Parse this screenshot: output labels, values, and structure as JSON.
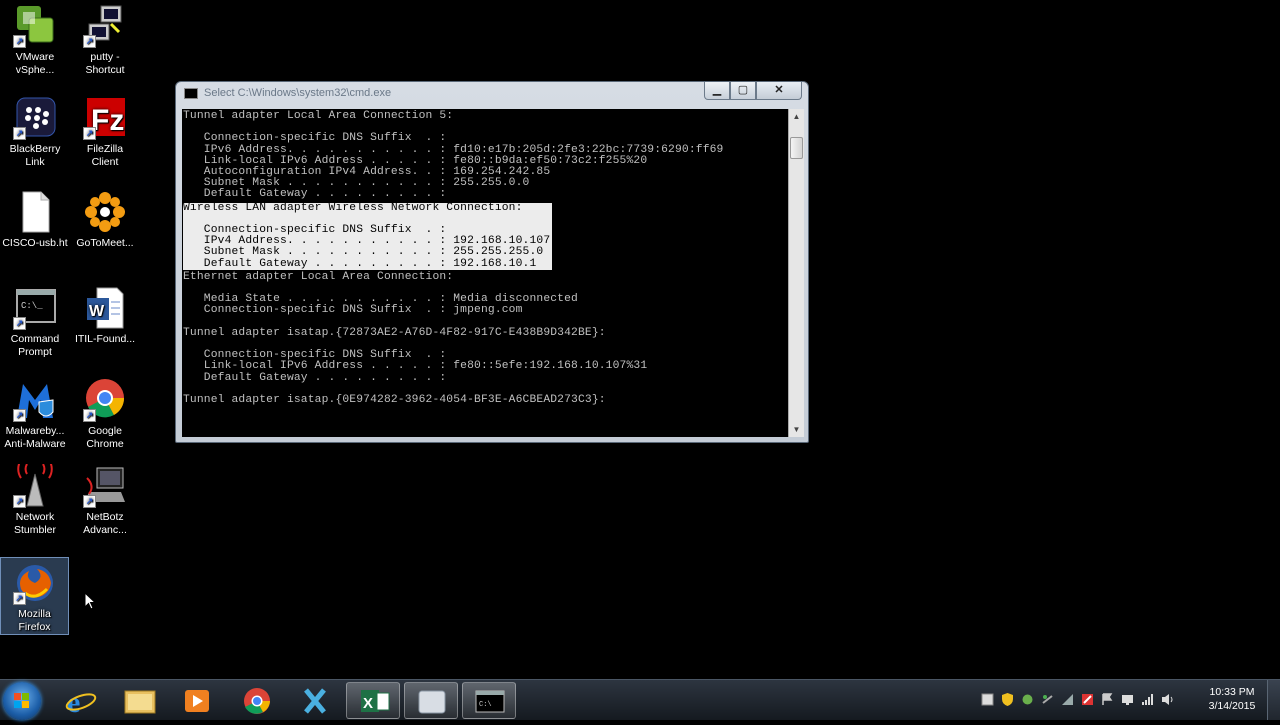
{
  "desktop": {
    "icons": [
      {
        "label_1": "VMware",
        "label_2": "vSphe..."
      },
      {
        "label_1": "putty -",
        "label_2": "Shortcut"
      },
      {
        "label_1": "BlackBerry",
        "label_2": "Link"
      },
      {
        "label_1": "FileZilla",
        "label_2": "Client"
      },
      {
        "label_1": "CISCO-usb.ht",
        "label_2": ""
      },
      {
        "label_1": "GoToMeet...",
        "label_2": ""
      },
      {
        "label_1": "Command",
        "label_2": "Prompt"
      },
      {
        "label_1": "ITIL-Found...",
        "label_2": ""
      },
      {
        "label_1": "Malwareby...",
        "label_2": "Anti-Malware"
      },
      {
        "label_1": "Google",
        "label_2": "Chrome"
      },
      {
        "label_1": "Network",
        "label_2": "Stumbler"
      },
      {
        "label_1": "NetBotz",
        "label_2": "Advanc..."
      },
      {
        "label_1": "Mozilla",
        "label_2": "Firefox"
      }
    ]
  },
  "cmd_window": {
    "title": "Select C:\\Windows\\system32\\cmd.exe",
    "min_label": "▁",
    "max_label": "▢",
    "close_label": "✕",
    "console": {
      "block1": "Tunnel adapter Local Area Connection 5:\n\n   Connection-specific DNS Suffix  . :\n   IPv6 Address. . . . . . . . . . . : fd10:e17b:205d:2fe3:22bc:7739:6290:ff69\n   Link-local IPv6 Address . . . . . : fe80::b9da:ef50:73c2:f255%20\n   Autoconfiguration IPv4 Address. . : 169.254.242.85\n   Subnet Mask . . . . . . . . . . . : 255.255.0.0\n   Default Gateway . . . . . . . . . :\n",
      "highlight": "Wireless LAN adapter Wireless Network Connection:\n\n   Connection-specific DNS Suffix  . :\n   IPv4 Address. . . . . . . . . . . : 192.168.10.107\n   Subnet Mask . . . . . . . . . . . : 255.255.255.0\n   Default Gateway . . . . . . . . . : 192.168.10.1\n",
      "block2": "Ethernet adapter Local Area Connection:\n\n   Media State . . . . . . . . . . . : Media disconnected\n   Connection-specific DNS Suffix  . : jmpeng.com\n\nTunnel adapter isatap.{72873AE2-A76D-4F82-917C-E438B9D342BE}:\n\n   Connection-specific DNS Suffix  . :\n   Link-local IPv6 Address . . . . . : fe80::5efe:192.168.10.107%31\n   Default Gateway . . . . . . . . . :\n\nTunnel adapter isatap.{0E974282-3962-4054-BF3E-A6CBEAD273C3}:"
    }
  },
  "taskbar": {
    "clock_time": "10:33 PM",
    "clock_date": "3/14/2015"
  }
}
